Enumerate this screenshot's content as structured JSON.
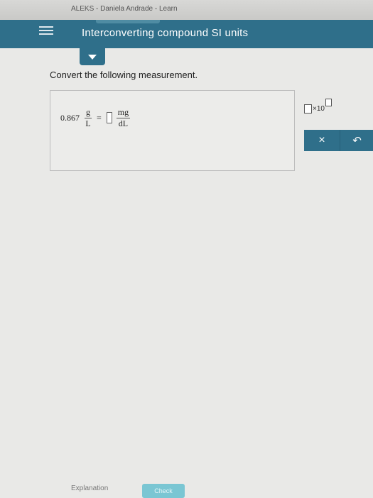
{
  "browser": {
    "title": "ALEKS - Daniela Andrade - Learn"
  },
  "header": {
    "title": "Interconverting compound SI units",
    "menu_icon": "hamburger-icon"
  },
  "tab": {
    "icon": "chevron-down-icon"
  },
  "problem": {
    "prompt": "Convert the following measurement.",
    "value": "0.867",
    "from_numerator": "g",
    "from_denominator": "L",
    "equals": "=",
    "to_numerator": "mg",
    "to_denominator": "dL"
  },
  "tools": {
    "sci_notation_label": "×10",
    "clear_label": "×",
    "undo_label": "↶"
  },
  "footer": {
    "explanation_label": "Explanation",
    "check_label": "Check"
  },
  "colors": {
    "header": "#2f6f8a",
    "check_button": "#7ac6d3"
  }
}
